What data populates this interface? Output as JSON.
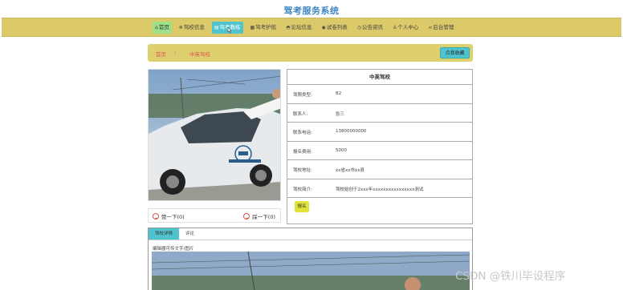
{
  "site": {
    "title": "驾考服务系统"
  },
  "nav": {
    "items": [
      {
        "label": "首页",
        "icon": "home-icon"
      },
      {
        "label": "驾校信息",
        "icon": "snowflake-icon"
      },
      {
        "label": "驾考教练",
        "icon": "id-card-icon"
      },
      {
        "label": "驾考护航",
        "icon": "grid-icon"
      },
      {
        "label": "论坛信息",
        "icon": "cap-icon"
      },
      {
        "label": "试卷列表",
        "icon": "disc-icon"
      },
      {
        "label": "公告资讯",
        "icon": "clock-icon"
      },
      {
        "label": "个人中心",
        "icon": "user-icon"
      },
      {
        "label": "后台管理",
        "icon": "link-icon"
      }
    ],
    "active_index": 2
  },
  "breadcrumb": {
    "home": "首页",
    "separator": "/",
    "current": "中英驾校",
    "back_label": "点我收藏"
  },
  "school": {
    "name": "中英驾校",
    "rows": [
      {
        "label": "驾照类型:",
        "value": "B2"
      },
      {
        "label": "联系人:",
        "value": "张三"
      },
      {
        "label": "联系电话:",
        "value": "13800000000"
      },
      {
        "label": "报名费用:",
        "value": "5000"
      },
      {
        "label": "驾校地址:",
        "value": "xx省xx市xx县"
      },
      {
        "label": "驾校简介:",
        "value": "驾校始创于2xxx年xxxxxxxxxxxxxxxx测试"
      }
    ],
    "signup_label": "报名"
  },
  "votes": {
    "like_label": "赞一下(0)",
    "dislike_label": "踩一下(0)"
  },
  "tabs": {
    "items": [
      "驾校详情",
      "评论"
    ],
    "active_index": 0
  },
  "detail": {
    "hint": "编辑器可传文字/图片"
  },
  "watermark": "CSDN @铁川毕设程序",
  "colors": {
    "nav_bg": "#dcc96a",
    "accent": "#4fc4cf",
    "title": "#3f86c6",
    "link_red": "#d9534f"
  }
}
